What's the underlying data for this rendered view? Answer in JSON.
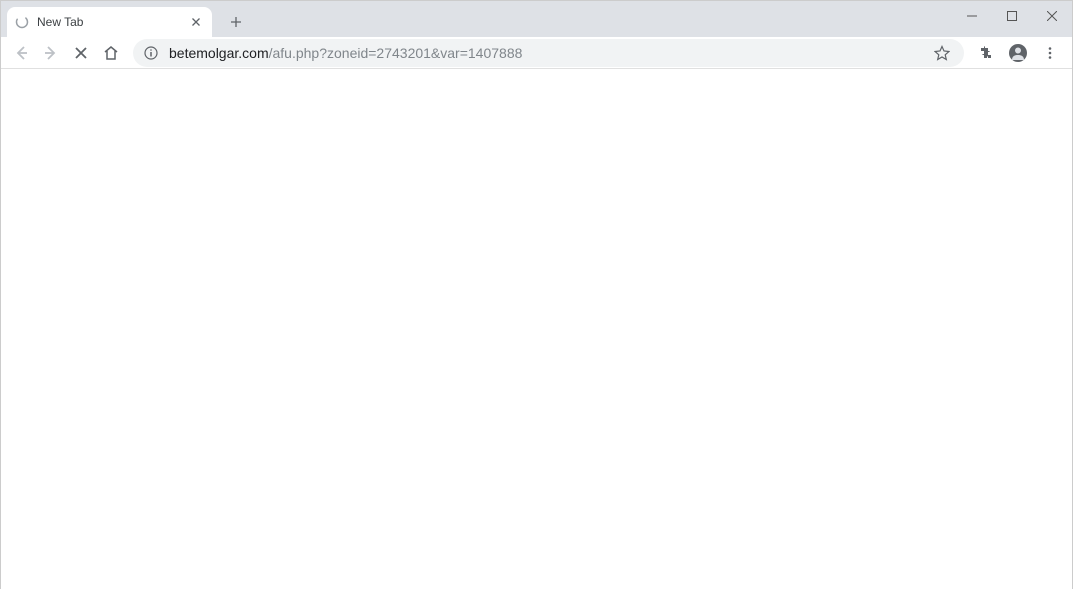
{
  "tab": {
    "title": "New Tab"
  },
  "address": {
    "domain": "betemolgar.com",
    "path": "/afu.php?zoneid=2743201&var=1407888"
  }
}
